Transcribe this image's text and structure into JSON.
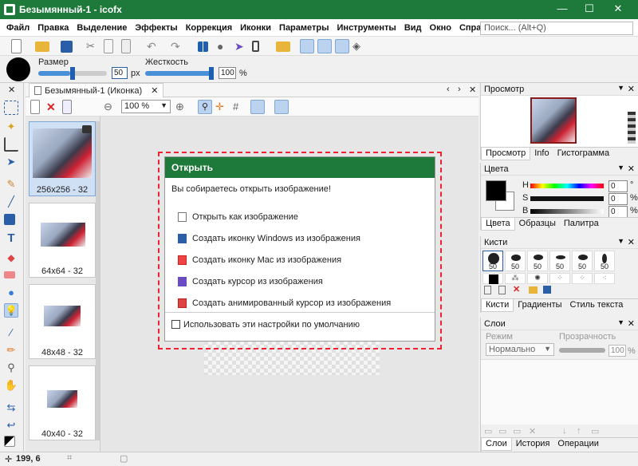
{
  "window": {
    "title": "Безымянный-1 - icofx",
    "min": "—",
    "max": "☐",
    "close": "✕"
  },
  "menu": [
    "Файл",
    "Правка",
    "Выделение",
    "Эффекты",
    "Коррекция",
    "Иконки",
    "Параметры",
    "Инструменты",
    "Вид",
    "Окно",
    "Справка"
  ],
  "search": {
    "placeholder": "Поиск... (Alt+Q)"
  },
  "options": {
    "size_label": "Размер",
    "size_value": "50",
    "size_unit": "px",
    "hardness_label": "Жесткость",
    "hardness_value": "100",
    "hardness_unit": "%"
  },
  "document": {
    "tab": "Безымянный-1 (Иконка)",
    "zoom": "100 %"
  },
  "thumbnails": [
    {
      "label": "256x256 - 32"
    },
    {
      "label": "64x64 - 32"
    },
    {
      "label": "48x48 - 32"
    },
    {
      "label": "40x40 - 32"
    }
  ],
  "dialog": {
    "title": "Открыть",
    "message": "Вы собираетесь открыть изображение!",
    "options": [
      "Открыть как изображение",
      "Создать иконку Windows из изображения",
      "Создать иконку Mac из изображения",
      "Создать курсор из изображения",
      "Создать анимированный курсор из изображения"
    ],
    "default_checkbox": "Использовать эти настройки по умолчанию"
  },
  "preview_panel": {
    "title": "Просмотр",
    "tabs": [
      "Просмотр",
      "Info",
      "Гистограмма"
    ]
  },
  "colors_panel": {
    "title": "Цвета",
    "hsb": [
      {
        "label": "H",
        "value": "0",
        "unit": "°"
      },
      {
        "label": "S",
        "value": "0",
        "unit": "%"
      },
      {
        "label": "B",
        "value": "0",
        "unit": "%"
      }
    ],
    "tabs": [
      "Цвета",
      "Образцы",
      "Палитра"
    ]
  },
  "brushes_panel": {
    "title": "Кисти",
    "sizes": [
      "50",
      "50",
      "50",
      "50",
      "50",
      "50"
    ],
    "tabs": [
      "Кисти",
      "Градиенты",
      "Стиль текста"
    ]
  },
  "layers_panel": {
    "title": "Слои",
    "mode_label": "Режим",
    "mode_value": "Нормально",
    "opacity_label": "Прозрачность",
    "opacity_value": "100",
    "opacity_unit": "%",
    "tabs": [
      "Слои",
      "История",
      "Операции"
    ]
  },
  "status": {
    "coords": "199, 6"
  },
  "colors": {
    "accent": "#1e7a3a",
    "highlight": "#e22233"
  }
}
